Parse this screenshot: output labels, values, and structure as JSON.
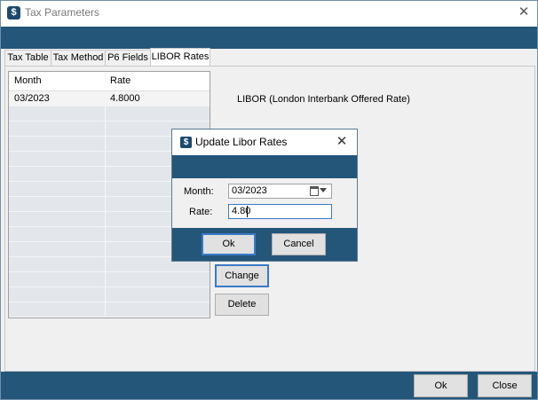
{
  "window": {
    "title": "Tax Parameters"
  },
  "tabs": [
    {
      "label": "Tax Table"
    },
    {
      "label": "Tax Method"
    },
    {
      "label": "P6 Fields"
    },
    {
      "label": "LIBOR Rates",
      "active": true
    }
  ],
  "grid": {
    "columns": [
      "Month",
      "Rate"
    ],
    "rows": [
      {
        "month": "03/2023",
        "rate": "4.8000"
      }
    ]
  },
  "libor_label": "LIBOR (London Interbank Offered Rate)",
  "side_buttons": {
    "change": "Change",
    "delete": "Delete"
  },
  "dialog": {
    "title": "Update Libor Rates",
    "month_label": "Month:",
    "month_value": "03/2023",
    "rate_label": "Rate:",
    "rate_value": "4.80",
    "ok": "Ok",
    "cancel": "Cancel"
  },
  "footer": {
    "ok": "Ok",
    "close": "Close"
  },
  "colors": {
    "accent_band": "#24567a",
    "focus_border": "#3a7ac8"
  },
  "icons": {
    "app": "app-dollar-icon",
    "close": "close-icon",
    "calendar": "calendar-icon",
    "dropdown": "chevron-down-icon"
  }
}
